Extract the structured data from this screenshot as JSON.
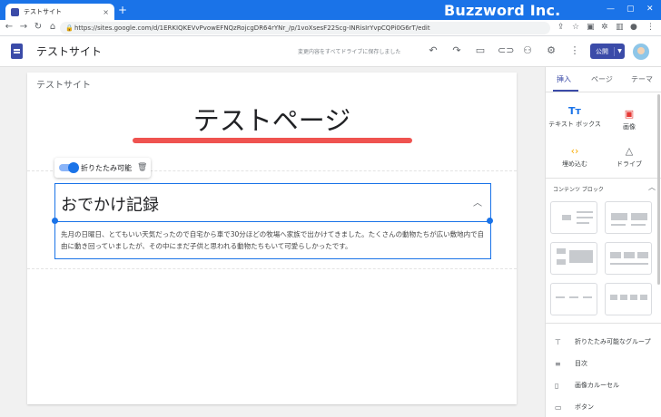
{
  "browser": {
    "tab_title": "テストサイト",
    "tab_close": "×",
    "new_tab": "+",
    "brand": "Buzzword Inc.",
    "url": "https://sites.google.com/d/1ERKIQKEVvPvowEFNQzRojcgDR64rYNr_/p/1voXsesF22Scg-INRisIrYvpCQPi0G6rT/edit",
    "nav_icons": [
      "back-icon",
      "forward-icon",
      "reload-icon",
      "home-icon"
    ]
  },
  "app": {
    "site_name": "テストサイト",
    "save_message": "変更内容をすべてドライブに保存しました",
    "publish_label": "公開",
    "header_icons": [
      "undo-icon",
      "redo-icon",
      "preview-icon",
      "link-icon",
      "share-icon",
      "settings-icon",
      "more-icon"
    ]
  },
  "page": {
    "site_title": "テストサイト",
    "heading": "テストページ",
    "accent_color": "#ef5350",
    "toggle_label": "折りたたみ可能",
    "toggle_on": true,
    "collapsible": {
      "title": "おでかけ記録",
      "body": "先月の日曜日、とてもいい天気だったので自宅から車で30分ほどの牧場へ家族で出かけてきました。たくさんの動物たちが広い敷地内で自由に動き回っていましたが、その中にまだ子供と思われる動物たちもいて可愛らしかったです。"
    }
  },
  "panel": {
    "tabs": [
      "挿入",
      "ページ",
      "テーマ"
    ],
    "active_tab": "挿入",
    "insert_items": [
      {
        "label": "テキスト ボックス",
        "icon": "text-box-icon",
        "glyph": "Tт"
      },
      {
        "label": "画像",
        "icon": "image-icon",
        "glyph": "▣"
      },
      {
        "label": "埋め込む",
        "icon": "embed-icon",
        "glyph": "‹›"
      },
      {
        "label": "ドライブ",
        "icon": "drive-icon",
        "glyph": "△"
      }
    ],
    "blocks_header": "コンテンツ ブロック",
    "list_items": [
      {
        "label": "折りたたみ可能なグループ",
        "icon": "collapsible-group-icon",
        "glyph": "⊤"
      },
      {
        "label": "目次",
        "icon": "toc-icon",
        "glyph": "≡"
      },
      {
        "label": "画像カルーセル",
        "icon": "carousel-icon",
        "glyph": "▯"
      },
      {
        "label": "ボタン",
        "icon": "button-icon",
        "glyph": "▭"
      }
    ]
  }
}
